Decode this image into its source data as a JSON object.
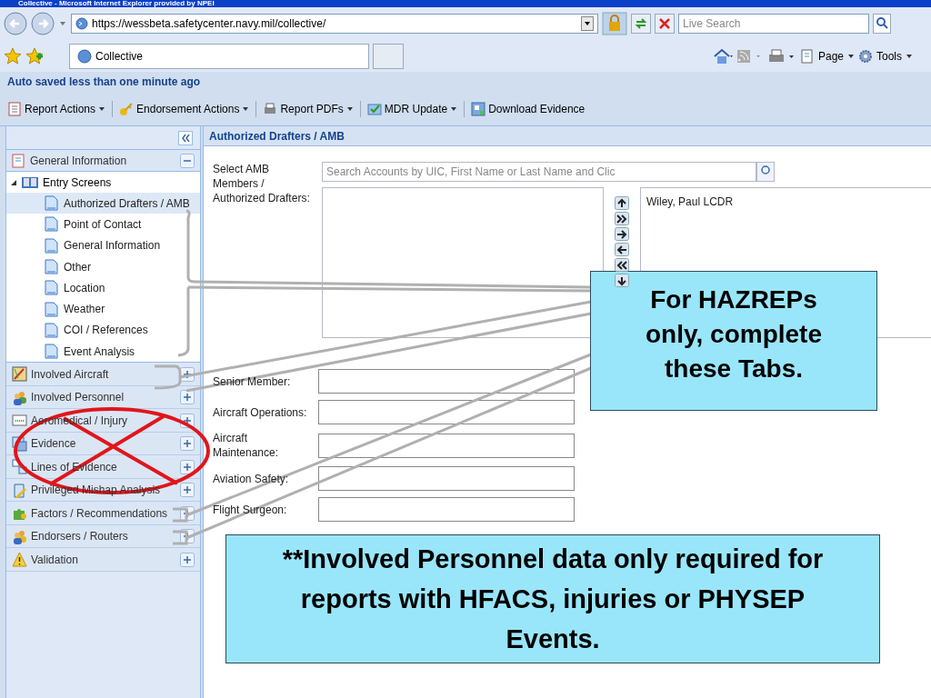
{
  "window": {
    "title": "Collective - Microsoft Internet Explorer provided by NPEI"
  },
  "address_bar": {
    "url": "https://wessbeta.safetycenter.navy.mil/collective/",
    "search_placeholder": "Live Search"
  },
  "browser_tabs": [
    {
      "label": "Collective",
      "selected": true
    }
  ],
  "command_bar": [
    {
      "label": "Page"
    },
    {
      "label": "Tools"
    }
  ],
  "autosave_status": "Auto saved less than one minute ago",
  "toolbar": [
    {
      "label": "Report Actions",
      "has_menu": true
    },
    {
      "label": "Endorsement Actions",
      "has_menu": true
    },
    {
      "label": "Report PDFs",
      "has_menu": true
    },
    {
      "label": "MDR Update",
      "has_menu": true
    },
    {
      "label": "Download Evidence",
      "has_menu": false
    }
  ],
  "sidebar": {
    "header": {
      "label": "General Information",
      "expanded": true
    },
    "tree": [
      {
        "label": "Entry Screens",
        "expanded": true,
        "children": [
          {
            "label": "Authorized Drafters / AMB",
            "selected": true
          },
          {
            "label": "Point of Contact",
            "selected": false
          },
          {
            "label": "General Information",
            "selected": false
          },
          {
            "label": "Other",
            "selected": false
          },
          {
            "label": "Location",
            "selected": false
          },
          {
            "label": "Weather",
            "selected": false
          },
          {
            "label": "COI / References",
            "selected": false
          },
          {
            "label": "Event Analysis",
            "selected": false
          }
        ]
      }
    ],
    "panels": [
      {
        "label": "Involved Aircraft",
        "expanded": false
      },
      {
        "label": "Involved Personnel",
        "expanded": false
      },
      {
        "label": "Aeromedical / Injury",
        "expanded": false
      },
      {
        "label": "Evidence",
        "expanded": false
      },
      {
        "label": "Lines of Evidence",
        "expanded": false
      },
      {
        "label": "Privileged Mishap Analysis",
        "expanded": false
      },
      {
        "label": "Factors / Recommendations",
        "expanded": false
      },
      {
        "label": "Endorsers / Routers",
        "expanded": false
      },
      {
        "label": "Validation",
        "expanded": false
      }
    ]
  },
  "content": {
    "title": "Authorized Drafters / AMB",
    "select_label": "Select AMB Members / Authorized Drafters:",
    "search_placeholder": "Search Accounts by UIC, First Name or Last Name and Clic",
    "selected_members": [
      "Wiley, Paul LCDR"
    ],
    "fields": [
      {
        "label": "Senior Member:"
      },
      {
        "label": "Aircraft Operations:"
      },
      {
        "label": "Aircraft Maintenance:"
      },
      {
        "label": "Aviation Safety:"
      },
      {
        "label": "Flight Surgeon:"
      }
    ]
  },
  "callouts": [
    {
      "text": "For HAZREPs only, complete these Tabs."
    },
    {
      "text": "**Involved Personnel data only required for reports with HFACS, injuries or PHYSEP Events."
    }
  ]
}
